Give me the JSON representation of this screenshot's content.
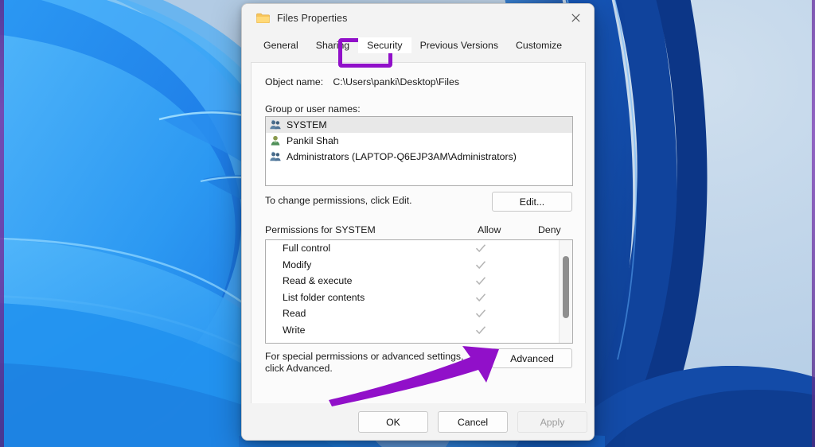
{
  "window": {
    "title": "Files Properties",
    "folder_icon": "folder-icon",
    "close_icon": "×"
  },
  "tabs": [
    {
      "label": "General",
      "selected": false
    },
    {
      "label": "Sharing",
      "selected": false
    },
    {
      "label": "Security",
      "selected": true
    },
    {
      "label": "Previous Versions",
      "selected": false
    },
    {
      "label": "Customize",
      "selected": false
    }
  ],
  "security": {
    "object_name_label": "Object name:",
    "object_name_value": "C:\\Users\\panki\\Desktop\\Files",
    "group_label": "Group or user names:",
    "principals": [
      {
        "name": "SYSTEM",
        "icon": "group-icon",
        "selected": true
      },
      {
        "name": "Pankil Shah",
        "icon": "user-icon",
        "selected": false
      },
      {
        "name": "Administrators (LAPTOP-Q6EJP3AM\\Administrators)",
        "icon": "group-icon",
        "selected": false
      }
    ],
    "edit_hint": "To change permissions, click Edit.",
    "edit_button": "Edit...",
    "permissions_for": "Permissions for SYSTEM",
    "col_allow": "Allow",
    "col_deny": "Deny",
    "permissions": [
      {
        "name": "Full control",
        "allow": true,
        "deny": false
      },
      {
        "name": "Modify",
        "allow": true,
        "deny": false
      },
      {
        "name": "Read & execute",
        "allow": true,
        "deny": false
      },
      {
        "name": "List folder contents",
        "allow": true,
        "deny": false
      },
      {
        "name": "Read",
        "allow": true,
        "deny": false
      },
      {
        "name": "Write",
        "allow": true,
        "deny": false
      }
    ],
    "advanced_hint_line1": "For special permissions or advanced settings,",
    "advanced_hint_line2": "click Advanced.",
    "advanced_button": "Advanced"
  },
  "footer": {
    "ok": "OK",
    "cancel": "Cancel",
    "apply": "Apply",
    "apply_disabled": true
  },
  "annotations": {
    "highlight_color": "#9110c9",
    "arrow_color": "#9110c9",
    "highlight_target": "Security",
    "arrow_target": "Advanced"
  }
}
